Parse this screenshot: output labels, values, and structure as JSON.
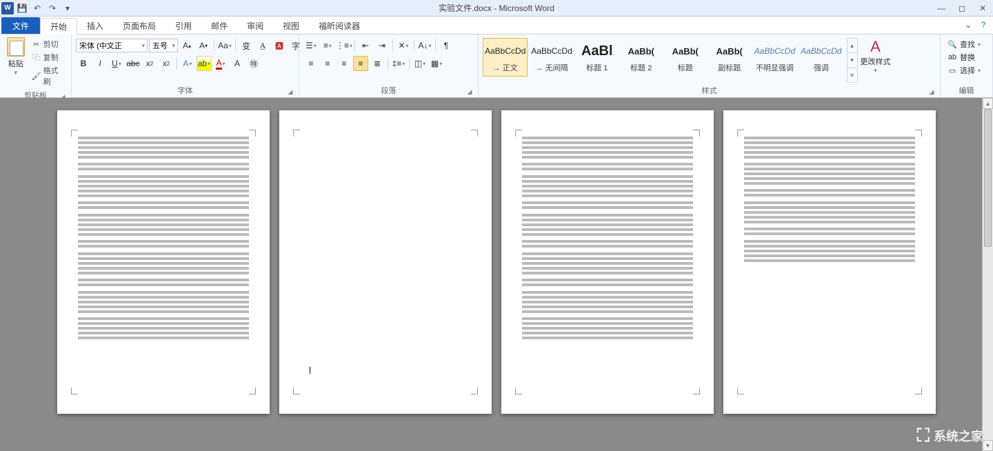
{
  "title": "实验文件.docx - Microsoft Word",
  "qat": {
    "save": "保存",
    "undo": "撤销",
    "redo": "重做"
  },
  "window": {
    "min": "最小化",
    "max": "最大化",
    "close": "关闭"
  },
  "tabs": {
    "file": "文件",
    "items": [
      "开始",
      "插入",
      "页面布局",
      "引用",
      "邮件",
      "审阅",
      "视图",
      "福昕阅读器"
    ],
    "active": "开始"
  },
  "groups": {
    "clipboard": {
      "label": "剪贴板",
      "paste": "粘贴",
      "cut": "剪切",
      "copy": "复制",
      "painter": "格式刷"
    },
    "font": {
      "label": "字体",
      "family": "宋体 (中文正",
      "size": "五号"
    },
    "paragraph": {
      "label": "段落"
    },
    "styles": {
      "label": "样式",
      "change": "更改样式",
      "items": [
        {
          "preview": "AaBbCcDd",
          "name": "→ 正文",
          "selected": true,
          "cls": ""
        },
        {
          "preview": "AaBbCcDd",
          "name": "→ 无间隔",
          "selected": false,
          "cls": ""
        },
        {
          "preview": "AaBl",
          "name": "标题 1",
          "selected": false,
          "cls": "big"
        },
        {
          "preview": "AaBb(",
          "name": "标题 2",
          "selected": false,
          "cls": "h1"
        },
        {
          "preview": "AaBb(",
          "name": "标题",
          "selected": false,
          "cls": "h1"
        },
        {
          "preview": "AaBb(",
          "name": "副标题",
          "selected": false,
          "cls": "h1"
        },
        {
          "preview": "AaBbCcDd",
          "name": "不明显强调",
          "selected": false,
          "cls": "italic"
        },
        {
          "preview": "AaBbCcDd",
          "name": "强调",
          "selected": false,
          "cls": "italic"
        }
      ]
    },
    "editing": {
      "label": "编辑",
      "find": "查找",
      "replace": "替换",
      "select": "选择"
    }
  },
  "watermark": "系统之家"
}
